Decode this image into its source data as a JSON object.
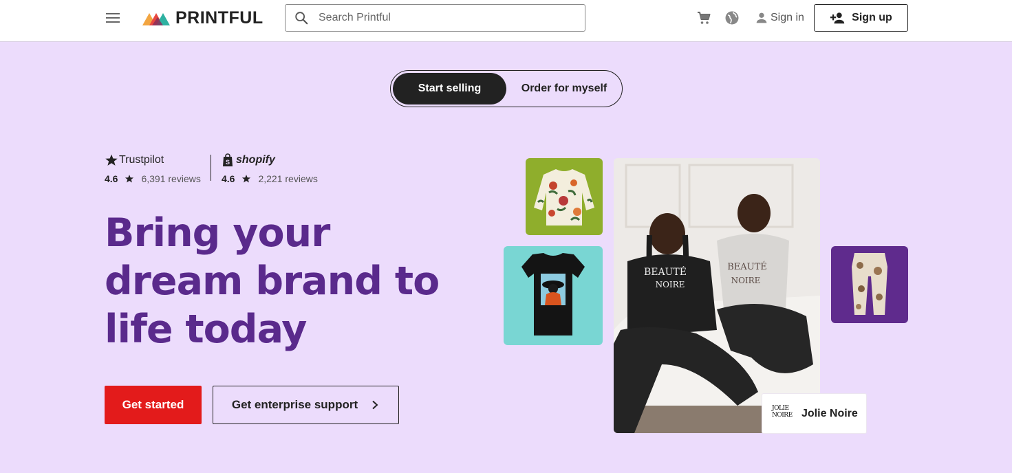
{
  "header": {
    "brand": "PRINTFUL",
    "search_placeholder": "Search Printful",
    "sign_in": "Sign in",
    "sign_up": "Sign up"
  },
  "toggle": {
    "active": "Start selling",
    "inactive": "Order for myself"
  },
  "ratings": {
    "trustpilot": {
      "brand": "Trustpilot",
      "score": "4.6",
      "count": "6,391 reviews"
    },
    "shopify": {
      "brand": "shopify",
      "score": "4.6",
      "count": "2,221 reviews"
    }
  },
  "hero": {
    "headline": "Bring your dream brand to life today",
    "cta_primary": "Get started",
    "cta_secondary": "Get enterprise support"
  },
  "showcase": {
    "brand_mark": "JOLIE NOIRE",
    "brand_name": "Jolie Noire"
  },
  "colors": {
    "background": "#ECDCFC",
    "headline": "#5A2A8C",
    "cta_red": "#E31B1B",
    "dark": "#222222"
  },
  "icons": [
    "menu-icon",
    "printful-logo-icon",
    "search-icon",
    "cart-icon",
    "globe-icon",
    "user-icon",
    "add-user-icon",
    "trustpilot-star-icon",
    "shopify-bag-icon",
    "star-icon",
    "chevron-right-icon"
  ]
}
